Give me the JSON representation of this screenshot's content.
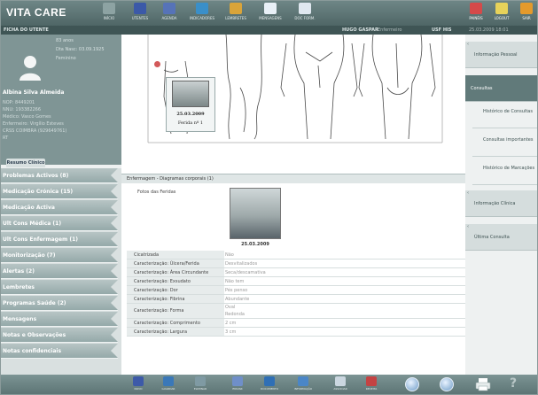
{
  "app": {
    "logo": "VITA CARE"
  },
  "toolbar": {
    "items": [
      {
        "label": "INÍCIO",
        "color": "#8da3a3"
      },
      {
        "label": "UTENTES",
        "color": "#3b59a8"
      },
      {
        "label": "AGENDA",
        "color": "#5673b8"
      },
      {
        "label": "INDICADORES",
        "color": "#3a8fc9"
      },
      {
        "label": "LEMBRETES",
        "color": "#d9a43a"
      },
      {
        "label": "MENSAGENS",
        "color": "#e8f0f7"
      },
      {
        "label": "DOC FORM.",
        "color": "#dfe7ef"
      }
    ],
    "right_items": [
      {
        "label": "PAINÉIS",
        "color": "#d44a4a"
      },
      {
        "label": "LOGOUT",
        "color": "#e7d25a"
      },
      {
        "label": "SAIR",
        "color": "#e49a2c"
      }
    ]
  },
  "subbar": {
    "left": "FICHA DO UTENTE",
    "user": "HUGO GASPAR",
    "role": "Enfermeiro",
    "usf": "USF HIS",
    "datetime": "25.03.2009 18:01"
  },
  "patient": {
    "age": "83 anos",
    "birth": "Dta Nasc: 03.09.1925",
    "gender": "Feminino",
    "name": "Albina Silva Almeida",
    "details": [
      "NOP: 8449201",
      "NNU: 193382266",
      "Médico: Vasco Gomes",
      "Enfermeiro: Virgílio Esteves",
      "CRSS COIMBRA (929649761)",
      "RT"
    ],
    "tab": "Resumo Clínico"
  },
  "leftmenu": [
    "Problemas Activos (8)",
    "Medicação Crónica (15)",
    "Medicação Activa",
    "Ult Cons Médica (1)",
    "Ult Cons Enfermagem (1)",
    "Monitorização (7)",
    "Alertas (2)",
    "Lembretes",
    "Programas Saúde (2)",
    "Mensagens",
    "Notas e Observações",
    "Notas confidenciais"
  ],
  "woundcard": {
    "date": "25.03.2009",
    "label": "Ferida nº 1"
  },
  "section": {
    "title": "Enfermagem - Diagramas corporais (1)",
    "photos_label": "Fotos das Feridas",
    "photo_date": "25.03.2009"
  },
  "properties": [
    {
      "k": "Cicatrizada",
      "v": [
        "Não"
      ]
    },
    {
      "k": "Caracterização: Úlcera/Ferida",
      "v": [
        "Desvitalizados"
      ]
    },
    {
      "k": "Caracterização: Área Circundante",
      "v": [
        "Seca/descamativa"
      ]
    },
    {
      "k": "Caracterização: Exsudato",
      "v": [
        "Não tem"
      ]
    },
    {
      "k": "Caracterização: Dor",
      "v": [
        "Pés penso"
      ]
    },
    {
      "k": "Caracterização: Fibrina",
      "v": [
        "Abundante"
      ]
    },
    {
      "k": "Caracterização: Forma",
      "v": [
        "Oval",
        "Redonda"
      ]
    },
    {
      "k": "Caracterização: Comprimento",
      "v": [
        "2 cm"
      ]
    },
    {
      "k": "Caracterização: Largura",
      "v": [
        "3 cm"
      ]
    }
  ],
  "rightpanel": {
    "info_pessoal": "Informação Pessoal",
    "consultas": "Consultas",
    "sub": [
      "Histórico de Consultas",
      "Consultas importantes",
      "Histórico de Marcações"
    ],
    "info_clinica": "Informação Clínica",
    "ultima": "Última Consulta"
  },
  "bottombar": {
    "items": [
      {
        "label": "NOVO",
        "color": "#3d5aa8"
      },
      {
        "label": "GUARDAR",
        "color": "#3a78b8"
      },
      {
        "label": "ELIMINAR",
        "color": "#7f9aa3"
      },
      {
        "label": "ENVIAR",
        "color": "#6f8fc9"
      },
      {
        "label": "DOCUMENTO",
        "color": "#2f6fb5"
      },
      {
        "label": "INFORMAÇÃO",
        "color": "#4a86c7"
      },
      {
        "label": "ASSOCIAR",
        "color": "#cbd7e0"
      },
      {
        "label": "RECEITA",
        "color": "#c44343"
      }
    ]
  }
}
